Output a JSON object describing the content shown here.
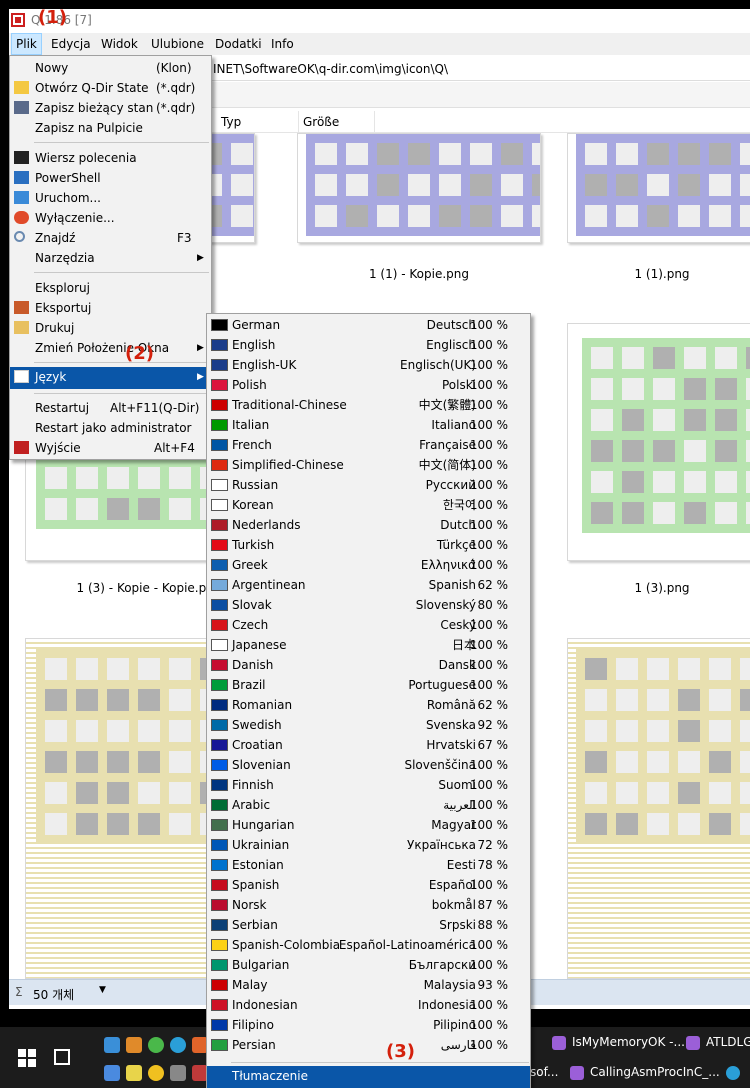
{
  "window": {
    "title": "Q-Dir 11.86 [7]",
    "title_visible": "Q 1.86 [7]"
  },
  "menubar": {
    "items": [
      {
        "label": "Plik"
      },
      {
        "label": "Edycja"
      },
      {
        "label": "Widok"
      },
      {
        "label": "Ulubione"
      },
      {
        "label": "Dodatki"
      },
      {
        "label": "Info"
      }
    ]
  },
  "address": {
    "path": "INET\\SoftwareOK\\q-dir.com\\img\\icon\\Q\\"
  },
  "columns": [
    {
      "label": "Typ"
    },
    {
      "label": "Größe"
    }
  ],
  "files": [
    {
      "caption": "1 (1) - Kopie.png"
    },
    {
      "caption": "1 (1).png"
    },
    {
      "caption": "1 (3) - Kopie - Kopie.png"
    },
    {
      "caption": "1 (3).png"
    }
  ],
  "status": {
    "count": "50 개체"
  },
  "plik_menu": {
    "items": [
      {
        "label": "Nowy",
        "shortcut": "(Klon)"
      },
      {
        "label": "Otwórz Q-Dir State",
        "shortcut": "(*.qdr)"
      },
      {
        "label": "Zapisz bieżący stan",
        "shortcut": "(*.qdr)"
      },
      {
        "label": "Zapisz na Pulpicie",
        "shortcut": ""
      },
      {
        "label": "Wiersz polecenia",
        "shortcut": ""
      },
      {
        "label": "PowerShell",
        "shortcut": ""
      },
      {
        "label": "Uruchom...",
        "shortcut": ""
      },
      {
        "label": "Wyłączenie...",
        "shortcut": ""
      },
      {
        "label": "Znajdź",
        "shortcut": "F3"
      },
      {
        "label": "Narzędzia",
        "shortcut": ""
      },
      {
        "label": "Eksploruj",
        "shortcut": ""
      },
      {
        "label": "Eksportuj",
        "shortcut": ""
      },
      {
        "label": "Drukuj",
        "shortcut": ""
      },
      {
        "label": "Zmień Położenie Okna",
        "shortcut": ""
      },
      {
        "label": "Język",
        "shortcut": ""
      },
      {
        "label": "Restartuj",
        "shortcut": "Alt+F11(Q-Dir)"
      },
      {
        "label": "Restart jako administrator",
        "shortcut": ""
      },
      {
        "label": "Wyjście",
        "shortcut": "Alt+F4"
      }
    ]
  },
  "language_menu": {
    "items": [
      {
        "name": "German",
        "native": "Deutsch",
        "pct": "100 %"
      },
      {
        "name": "English",
        "native": "Englisch",
        "pct": "100 %"
      },
      {
        "name": "English-UK",
        "native": "Englisch(UK)",
        "pct": "100 %"
      },
      {
        "name": "Polish",
        "native": "Polski",
        "pct": "100 %"
      },
      {
        "name": "Traditional-Chinese",
        "native": "中文(繁體)",
        "pct": "100 %"
      },
      {
        "name": "Italian",
        "native": "Italiano",
        "pct": "100 %"
      },
      {
        "name": "French",
        "native": "Française",
        "pct": "100 %"
      },
      {
        "name": "Simplified-Chinese",
        "native": "中文(简体)",
        "pct": "100 %"
      },
      {
        "name": "Russian",
        "native": "Русский",
        "pct": "100 %"
      },
      {
        "name": "Korean",
        "native": "한국어",
        "pct": "100 %"
      },
      {
        "name": "Nederlands",
        "native": "Dutch",
        "pct": "100 %"
      },
      {
        "name": "Turkish",
        "native": "Türkçe",
        "pct": "100 %"
      },
      {
        "name": "Greek",
        "native": "Ελληνικά",
        "pct": "100 %"
      },
      {
        "name": "Argentinean",
        "native": "Spanish",
        "pct": "62 %"
      },
      {
        "name": "Slovak",
        "native": "Slovenský",
        "pct": "80 %"
      },
      {
        "name": "Czech",
        "native": "Ceský",
        "pct": "100 %"
      },
      {
        "name": "Japanese",
        "native": "日本",
        "pct": "100 %"
      },
      {
        "name": "Danish",
        "native": "Dansk",
        "pct": "100 %"
      },
      {
        "name": "Brazil",
        "native": "Portuguese",
        "pct": "100 %"
      },
      {
        "name": "Romanian",
        "native": "Română",
        "pct": "62 %"
      },
      {
        "name": "Swedish",
        "native": "Svenska",
        "pct": "92 %"
      },
      {
        "name": "Croatian",
        "native": "Hrvatski",
        "pct": "67 %"
      },
      {
        "name": "Slovenian",
        "native": "Slovenščina",
        "pct": "100 %"
      },
      {
        "name": "Finnish",
        "native": "Suomi",
        "pct": "100 %"
      },
      {
        "name": "Arabic",
        "native": "العربية",
        "pct": "100 %"
      },
      {
        "name": "Hungarian",
        "native": "Magyar",
        "pct": "100 %"
      },
      {
        "name": "Ukrainian",
        "native": "Українська",
        "pct": "72 %"
      },
      {
        "name": "Estonian",
        "native": "Eesti",
        "pct": "78 %"
      },
      {
        "name": "Spanish",
        "native": "Español",
        "pct": "100 %"
      },
      {
        "name": "Norsk",
        "native": "bokmål",
        "pct": "87 %"
      },
      {
        "name": "Serbian",
        "native": "Srpski",
        "pct": "88 %"
      },
      {
        "name": "Spanish-Colombia",
        "native": "Español-Latinoamérica",
        "pct": "100 %"
      },
      {
        "name": "Bulgarian",
        "native": "Български",
        "pct": "100 %"
      },
      {
        "name": "Malay",
        "native": "Malaysia",
        "pct": "93 %"
      },
      {
        "name": "Indonesian",
        "native": "Indonesia",
        "pct": "100 %"
      },
      {
        "name": "Filipino",
        "native": "Pilipino",
        "pct": "100 %"
      },
      {
        "name": "Persian",
        "native": "فارسی",
        "pct": "100 %"
      }
    ],
    "translate_label": "Tłumaczenie"
  },
  "annotations": {
    "a1": "(1)",
    "a2": "(2)",
    "a3": "(3)"
  },
  "taskbar": {
    "items": [
      {
        "label": "IsMyMemoryOK -..."
      },
      {
        "label": "ATLDLG"
      },
      {
        "label": "sof..."
      },
      {
        "label": "CallingAsmProcInC_..."
      }
    ]
  },
  "colors": {
    "menu_highlight": "#0a56a8",
    "annotation": "#d4200c",
    "thumb_purple": "#a8a8e0",
    "thumb_green": "#b8e4b0",
    "thumb_yellow": "#e8e0b0"
  }
}
